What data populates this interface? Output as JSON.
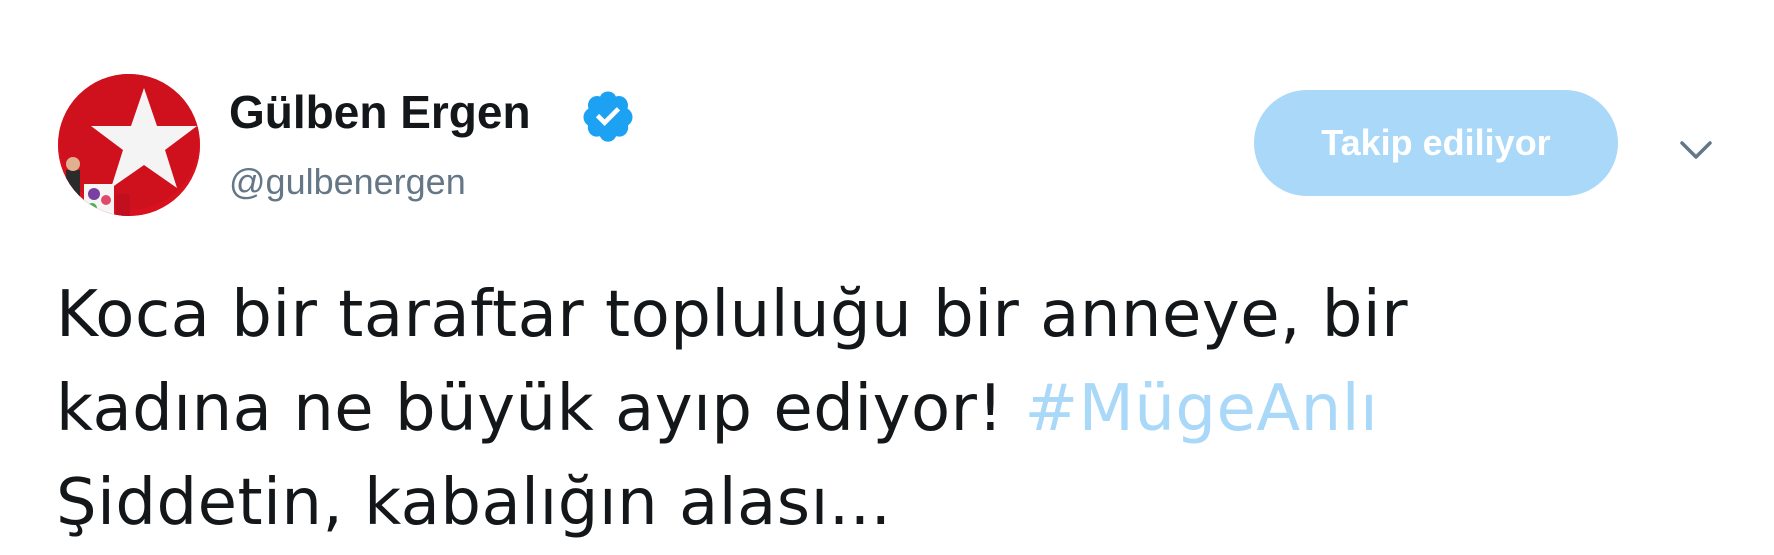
{
  "author": {
    "display_name": "Gülben Ergen",
    "handle": "@gulbenergen",
    "verified": true,
    "verified_icon": "verified-badge-icon"
  },
  "follow_button": {
    "label": "Takip ediliyor",
    "color": "#a9d8f8"
  },
  "menu": {
    "icon": "chevron-down-icon"
  },
  "tweet": {
    "line1": "Koca bir taraftar topluluğu bir anneye, bir",
    "line2_text": "kadına ne büyük ayıp ediyor! ",
    "hashtag": "#MügeAnlı",
    "line3": "Şiddetin, kabalığın alası..."
  },
  "colors": {
    "text": "#14171a",
    "secondary_text": "#657786",
    "accent": "#1da1f2",
    "hashtag_faded": "#a9d8f8",
    "avatar_red": "#d8121f"
  }
}
